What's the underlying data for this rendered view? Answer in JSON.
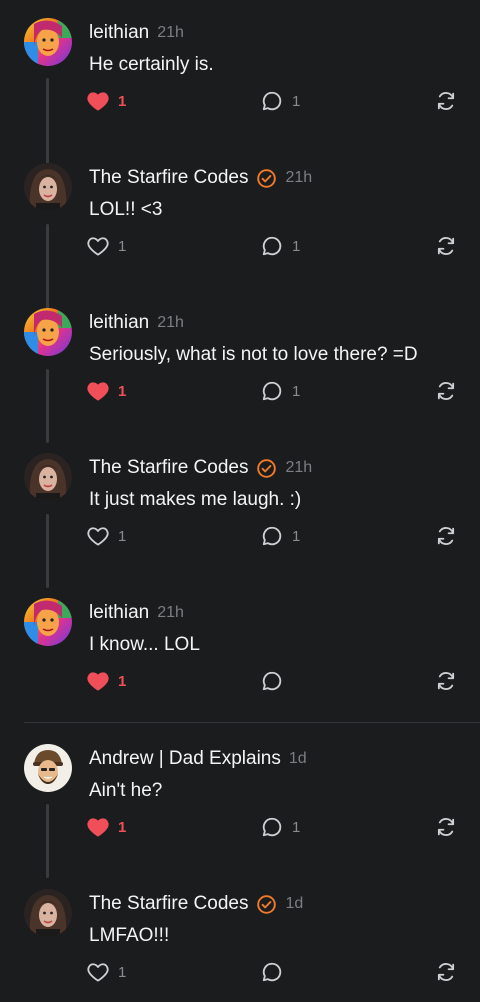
{
  "colors": {
    "background": "#1b1c1e",
    "text": "#f4f4f4",
    "muted": "#7d7e82",
    "like_active": "#f04f5a",
    "verified": "#f07a2a",
    "thread_line": "#3a3b3e"
  },
  "posts": [
    {
      "author": "leithian",
      "verified": false,
      "time": "21h",
      "text": "He certainly is.",
      "likes": "1",
      "liked": true,
      "replies": "1",
      "avatar": "leithian"
    },
    {
      "author": "The Starfire Codes",
      "verified": true,
      "time": "21h",
      "text": "LOL!! <3",
      "likes": "1",
      "liked": false,
      "replies": "1",
      "avatar": "starfire"
    },
    {
      "author": "leithian",
      "verified": false,
      "time": "21h",
      "text": "Seriously, what is not to love there? =D",
      "likes": "1",
      "liked": true,
      "replies": "1",
      "avatar": "leithian"
    },
    {
      "author": "The Starfire Codes",
      "verified": true,
      "time": "21h",
      "text": "It just makes me laugh. :)",
      "likes": "1",
      "liked": false,
      "replies": "1",
      "avatar": "starfire"
    },
    {
      "author": "leithian",
      "verified": false,
      "time": "21h",
      "text": "I know... LOL",
      "likes": "1",
      "liked": true,
      "replies": "",
      "avatar": "leithian"
    },
    {
      "author": "Andrew | Dad Explains",
      "verified": false,
      "time": "1d",
      "text": "Ain't he?",
      "likes": "1",
      "liked": true,
      "replies": "1",
      "avatar": "andrew"
    },
    {
      "author": "The Starfire Codes",
      "verified": true,
      "time": "1d",
      "text": "LMFAO!!!",
      "likes": "1",
      "liked": false,
      "replies": "",
      "avatar": "starfire"
    }
  ],
  "icons": {
    "like": "heart-icon",
    "reply": "speech-bubble-icon",
    "repost": "repost-arrows-icon",
    "verified": "verified-badge-icon"
  }
}
